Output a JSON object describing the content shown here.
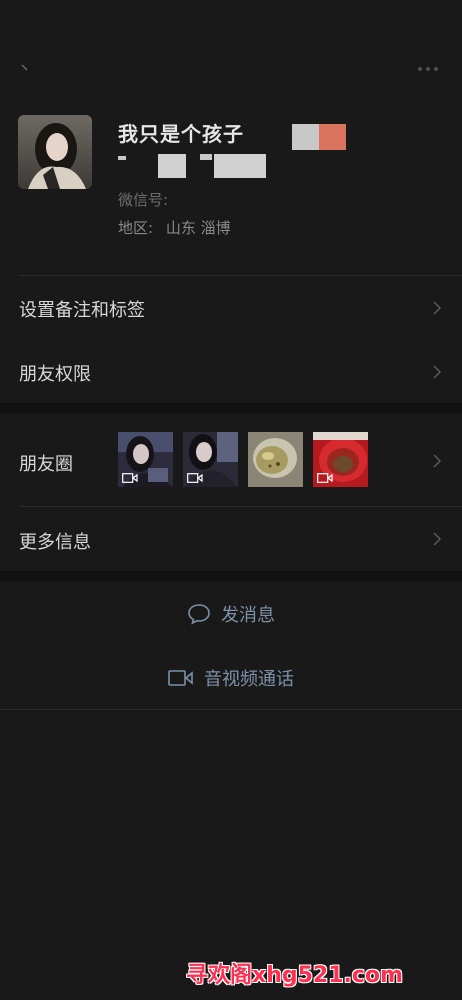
{
  "header": {
    "back_icon": "back-icon",
    "more_icon": "more-dots-icon"
  },
  "profile": {
    "nickname": "我只是个孩子",
    "wechat_id_label": "微信号: ",
    "wechat_id_value": "",
    "region_label": "地区: ",
    "region_value": "山东 淄博",
    "badge_colors": [
      "#c8c8c8",
      "#d9735e"
    ]
  },
  "menu": {
    "remark_tags": "设置备注和标签",
    "friend_permissions": "朋友权限",
    "moments": "朋友圈",
    "more_info": "更多信息"
  },
  "moments_thumbs": [
    {
      "type": "video",
      "desc": "selfie-1"
    },
    {
      "type": "video",
      "desc": "selfie-2"
    },
    {
      "type": "image",
      "desc": "food"
    },
    {
      "type": "video",
      "desc": "red-bowl"
    }
  ],
  "actions": {
    "send_message": "发消息",
    "video_call": "音视频通话"
  },
  "watermark": "寻欢阁xhg521.com",
  "colors": {
    "background": "#191919",
    "section_gap": "#111111",
    "action_text": "#7d90a9",
    "watermark": "#ff2f4f"
  }
}
